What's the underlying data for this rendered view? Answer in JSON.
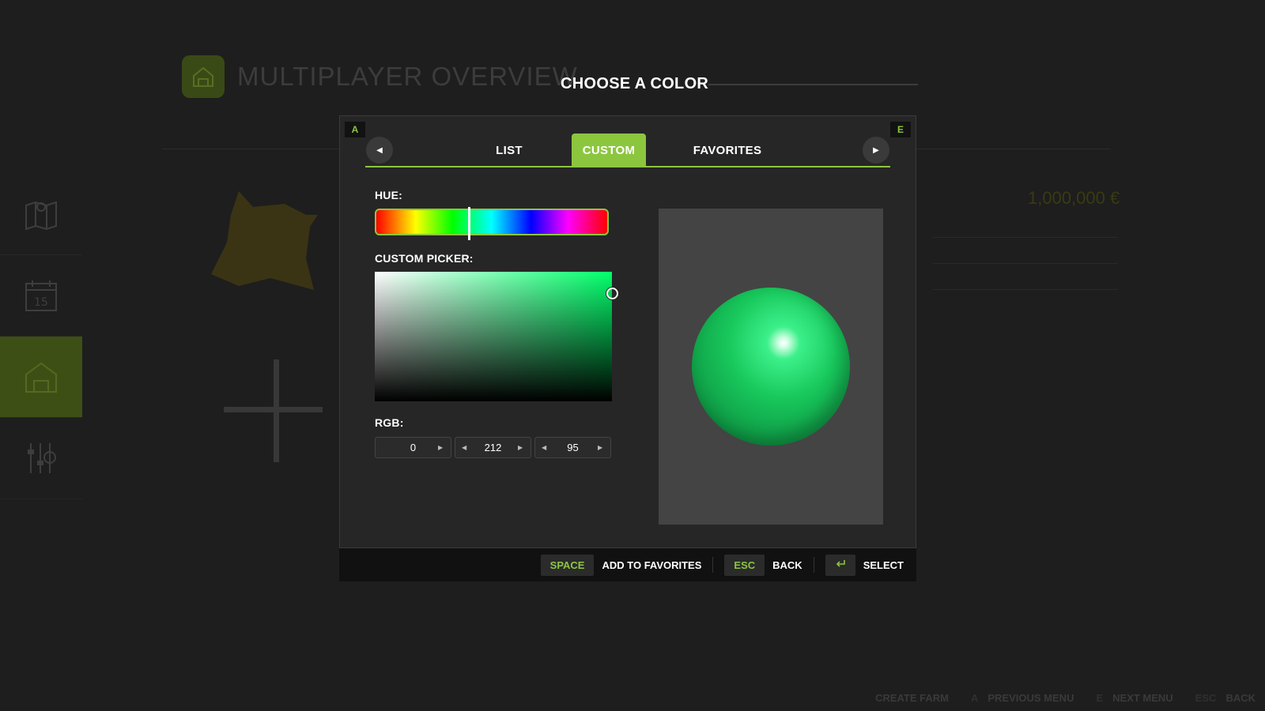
{
  "background": {
    "title": "MULTIPLAYER OVERVIEW",
    "money": "1,000,000 €",
    "footer": [
      {
        "key": "",
        "label": "CREATE FARM"
      },
      {
        "key": "A",
        "label": "PREVIOUS MENU"
      },
      {
        "key": "E",
        "label": "NEXT MENU"
      },
      {
        "key": "ESC",
        "label": "BACK"
      }
    ]
  },
  "dialog": {
    "title": "CHOOSE A COLOR",
    "corner_left": "A",
    "corner_right": "E",
    "tabs": [
      {
        "label": "LIST"
      },
      {
        "label": "CUSTOM"
      },
      {
        "label": "FAVORITES"
      }
    ],
    "active_tab": "CUSTOM",
    "hue_label": "HUE:",
    "hue_position": 0.4,
    "picker_label": "CUSTOM PICKER:",
    "rgb_label": "RGB:",
    "rgb": {
      "r": "0",
      "g": "212",
      "b": "95"
    },
    "preview_color": "#00d45f"
  },
  "buttons": [
    {
      "key": "SPACE",
      "label": "ADD TO FAVORITES"
    },
    {
      "key": "ESC",
      "label": "BACK"
    },
    {
      "key": "enter-icon",
      "label": "SELECT"
    }
  ],
  "colors": {
    "accent": "#8cc63f",
    "dialog_bg": "#262626",
    "page_bg": "#1e1e1e"
  }
}
